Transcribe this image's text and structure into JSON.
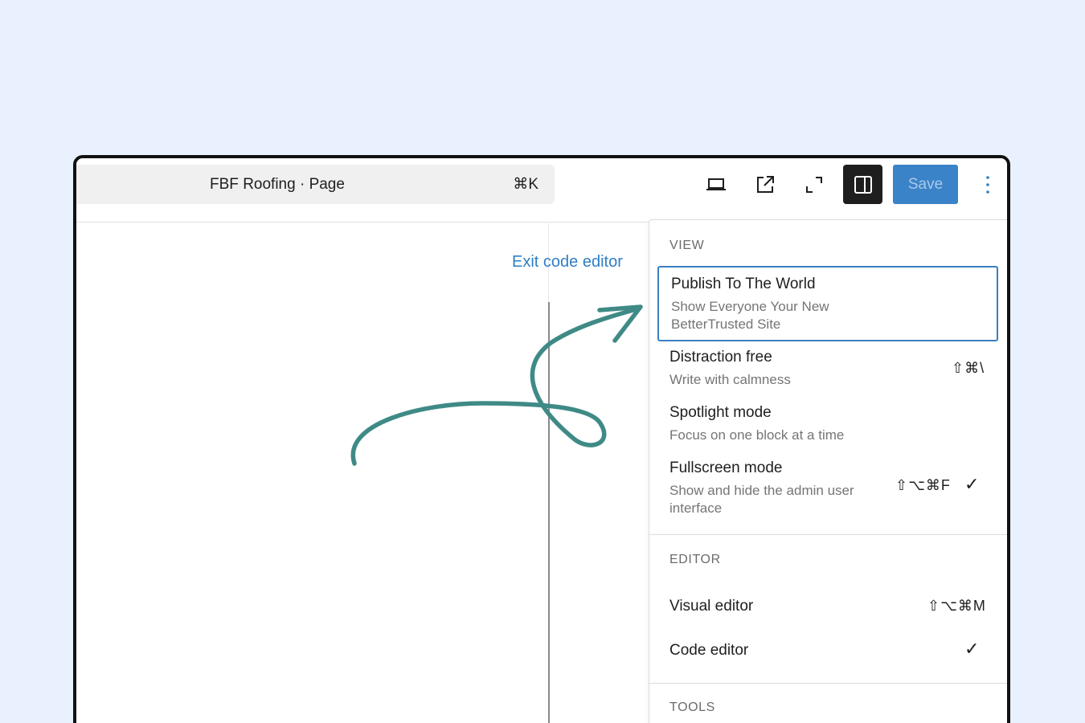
{
  "header": {
    "command_title": "FBF Roofing · Page",
    "command_shortcut": "⌘K",
    "icons": [
      "laptop-icon",
      "external-link-icon",
      "fullscreen-icon",
      "sidebar-toggle-icon",
      "more-vertical-icon"
    ],
    "save_label": "Save"
  },
  "editor": {
    "exit_code_editor": "Exit code editor"
  },
  "menu": {
    "view_label": "VIEW",
    "editor_label": "EDITOR",
    "tools_label": "TOOLS",
    "view_items": [
      {
        "title": "Publish To The World",
        "desc": "Show Everyone Your New BetterTrusted Site",
        "shortcut": "",
        "checked": false
      },
      {
        "title": "Distraction free",
        "desc": "Write with calmness",
        "shortcut": "⇧⌘\\",
        "checked": false
      },
      {
        "title": "Spotlight mode",
        "desc": "Focus on one block at a time",
        "shortcut": "",
        "checked": false
      },
      {
        "title": "Fullscreen mode",
        "desc": "Show and hide the admin user interface",
        "shortcut": "⇧⌥⌘F",
        "checked": true,
        "check": "✓"
      }
    ],
    "editor_items": [
      {
        "title": "Visual editor",
        "shortcut": "⇧⌥⌘M",
        "checked": false
      },
      {
        "title": "Code editor",
        "shortcut": "",
        "checked": true,
        "check": "✓"
      }
    ]
  },
  "colors": {
    "background": "#e8f1fd",
    "accent": "#3a83c8",
    "arrow": "#3f8a86"
  }
}
